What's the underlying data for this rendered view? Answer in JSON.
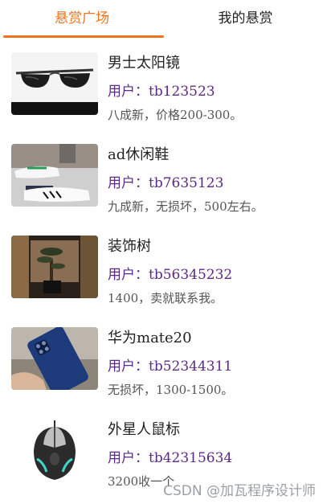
{
  "tabs": [
    {
      "label": "悬赏广场",
      "active": true
    },
    {
      "label": "我的悬赏",
      "active": false
    }
  ],
  "accent_color": "#f0741f",
  "user_color": "#5b2a86",
  "items": [
    {
      "image": "sunglasses",
      "title": "男士太阳镜",
      "user": "用户：tb123523",
      "desc": "八成新，价格200-300。"
    },
    {
      "image": "sneakers",
      "title": "ad休闲鞋",
      "user": "用户：tb7635123",
      "desc": "九成新，无损坏，500左右。"
    },
    {
      "image": "decorative-tree",
      "title": "装饰树",
      "user": "用户：tb56345232",
      "desc": "1400，卖就联系我。"
    },
    {
      "image": "smartphone",
      "title": "华为mate20",
      "user": "用户：tb52344311",
      "desc": "无损坏，1300-1500。"
    },
    {
      "image": "gaming-mouse",
      "title": "外星人鼠标",
      "user": "用户：tb42315634",
      "desc": "3200收一个"
    }
  ],
  "watermark": "CSDN @加瓦程序设计师"
}
